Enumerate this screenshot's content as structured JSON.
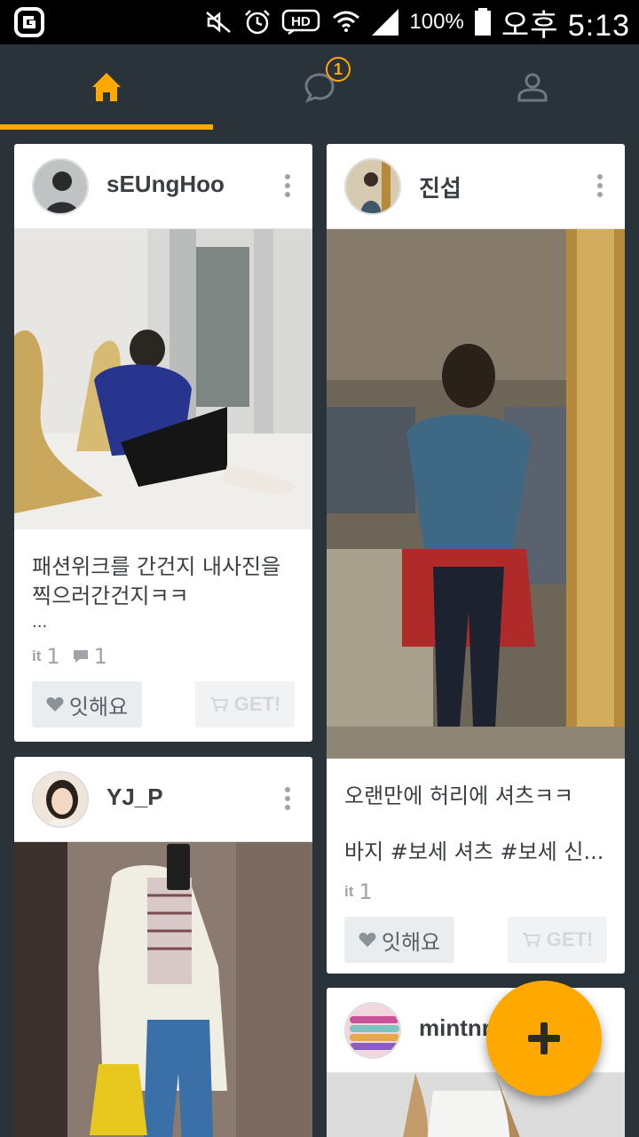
{
  "status_bar": {
    "battery": "100%",
    "time": "오후 5:13",
    "icons": [
      "app-logo-icon",
      "mute-icon",
      "alarm-icon",
      "hd-voice-icon",
      "wifi-icon",
      "signal-icon",
      "battery-icon"
    ]
  },
  "nav": {
    "tabs": [
      "home-icon",
      "chat-icon",
      "profile-icon"
    ],
    "chat_badge": "1",
    "accent_color": "#ffa800"
  },
  "cards": {
    "c1": {
      "username": "sEUngHoo",
      "caption_line1": "패션위크를 간건지 내사진을",
      "caption_line2": "찍으러간건지ㅋㅋ",
      "ellipsis": "...",
      "it_label": "it",
      "it_count": "1",
      "comment_count": "1",
      "like_label": "잇해요",
      "get_label": "GET!"
    },
    "c2": {
      "username": "진섭",
      "caption_line1": "오랜만에 허리에 셔츠ㅋㅋ",
      "caption_line2": "바지 #보세 셔츠 #보세 신...",
      "it_label": "it",
      "it_count": "1",
      "like_label": "잇해요",
      "get_label": "GET!"
    },
    "c3": {
      "username": "YJ_P"
    },
    "c4": {
      "username": "mintnr"
    }
  },
  "fab": {
    "icon": "plus-icon"
  }
}
